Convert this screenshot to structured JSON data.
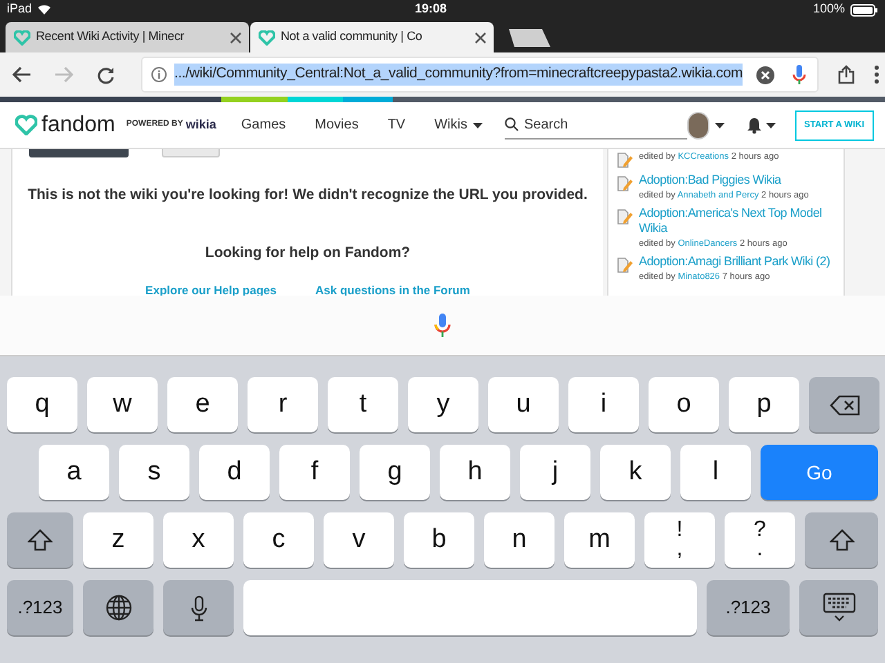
{
  "status_bar": {
    "device": "iPad",
    "time": "19:08",
    "battery": "100%"
  },
  "tabs": [
    {
      "title": "Recent Wiki Activity | Minecr",
      "selected": false
    },
    {
      "title": "Not a valid community | Co",
      "selected": true
    }
  ],
  "nav_buttons": [
    {
      "kind": "back",
      "disabled": false
    },
    {
      "kind": "forward",
      "disabled": true
    },
    {
      "kind": "reload",
      "disabled": false
    }
  ],
  "address_bar": {
    "url": ".../wiki/Community_Central:Not_a_valid_community?from=minecraftcreepypasta2.wikia.com",
    "selected": true
  },
  "fandom_nav": {
    "logo": "fandom",
    "powered_by": "POWERED BY",
    "brand": "wikia",
    "links": [
      {
        "label": "Games",
        "dropdown": false
      },
      {
        "label": "Movies",
        "dropdown": false
      },
      {
        "label": "TV",
        "dropdown": false
      },
      {
        "label": "Wikis",
        "dropdown": true
      }
    ],
    "search_placeholder": "Search",
    "cta": "START A WIKI"
  },
  "message": "This is not the wiki you're looking for! We didn't recognize the URL you provided.",
  "help": {
    "heading": "Looking for help on Fandom?",
    "links": [
      "Explore our Help pages",
      "Ask questions in the Forum"
    ]
  },
  "activity": [
    {
      "prefix": "edited by",
      "user": "KCCreations",
      "time": "2 hours ago"
    },
    {
      "title": "Adoption:Bad Piggies Wikia",
      "prefix": "edited by",
      "user": "Annabeth and Percy",
      "time": "2 hours ago"
    },
    {
      "title": "Adoption:America's Next Top Model Wikia",
      "prefix": "edited by",
      "user": "OnlineDancers",
      "time": "2 hours ago"
    },
    {
      "title": "Adoption:Amagi Brilliant Park Wiki (2)",
      "prefix": "edited by",
      "user": "Minato826",
      "time": "7 hours ago"
    }
  ],
  "keyboard": {
    "rows": [
      {
        "keys": [
          {
            "kind": "letter",
            "label": "q"
          },
          {
            "kind": "letter",
            "label": "w"
          },
          {
            "kind": "letter",
            "label": "e"
          },
          {
            "kind": "letter",
            "label": "r"
          },
          {
            "kind": "letter",
            "label": "t"
          },
          {
            "kind": "letter",
            "label": "y"
          },
          {
            "kind": "letter",
            "label": "u"
          },
          {
            "kind": "letter",
            "label": "i"
          },
          {
            "kind": "letter",
            "label": "o"
          },
          {
            "kind": "letter",
            "label": "p"
          },
          {
            "kind": "backspace"
          }
        ]
      },
      {
        "keys": [
          {
            "kind": "letter",
            "label": "a"
          },
          {
            "kind": "letter",
            "label": "s"
          },
          {
            "kind": "letter",
            "label": "d"
          },
          {
            "kind": "letter",
            "label": "f"
          },
          {
            "kind": "letter",
            "label": "g"
          },
          {
            "kind": "letter",
            "label": "h"
          },
          {
            "kind": "letter",
            "label": "j"
          },
          {
            "kind": "letter",
            "label": "k"
          },
          {
            "kind": "letter",
            "label": "l"
          },
          {
            "kind": "go",
            "label": "Go"
          }
        ]
      },
      {
        "keys": [
          {
            "kind": "shift"
          },
          {
            "kind": "letter",
            "label": "z"
          },
          {
            "kind": "letter",
            "label": "x"
          },
          {
            "kind": "letter",
            "label": "c"
          },
          {
            "kind": "letter",
            "label": "v"
          },
          {
            "kind": "letter",
            "label": "b"
          },
          {
            "kind": "letter",
            "label": "n"
          },
          {
            "kind": "letter",
            "label": "m"
          },
          {
            "kind": "dual",
            "upper": "!",
            "lower": ","
          },
          {
            "kind": "dual",
            "upper": "?",
            "lower": "."
          },
          {
            "kind": "shift"
          }
        ]
      },
      {
        "keys": [
          {
            "kind": "numbers",
            "label": ".?123"
          },
          {
            "kind": "globe"
          },
          {
            "kind": "dictation"
          },
          {
            "kind": "space"
          },
          {
            "kind": "numbers",
            "label": ".?123"
          },
          {
            "kind": "hide"
          }
        ]
      }
    ]
  }
}
